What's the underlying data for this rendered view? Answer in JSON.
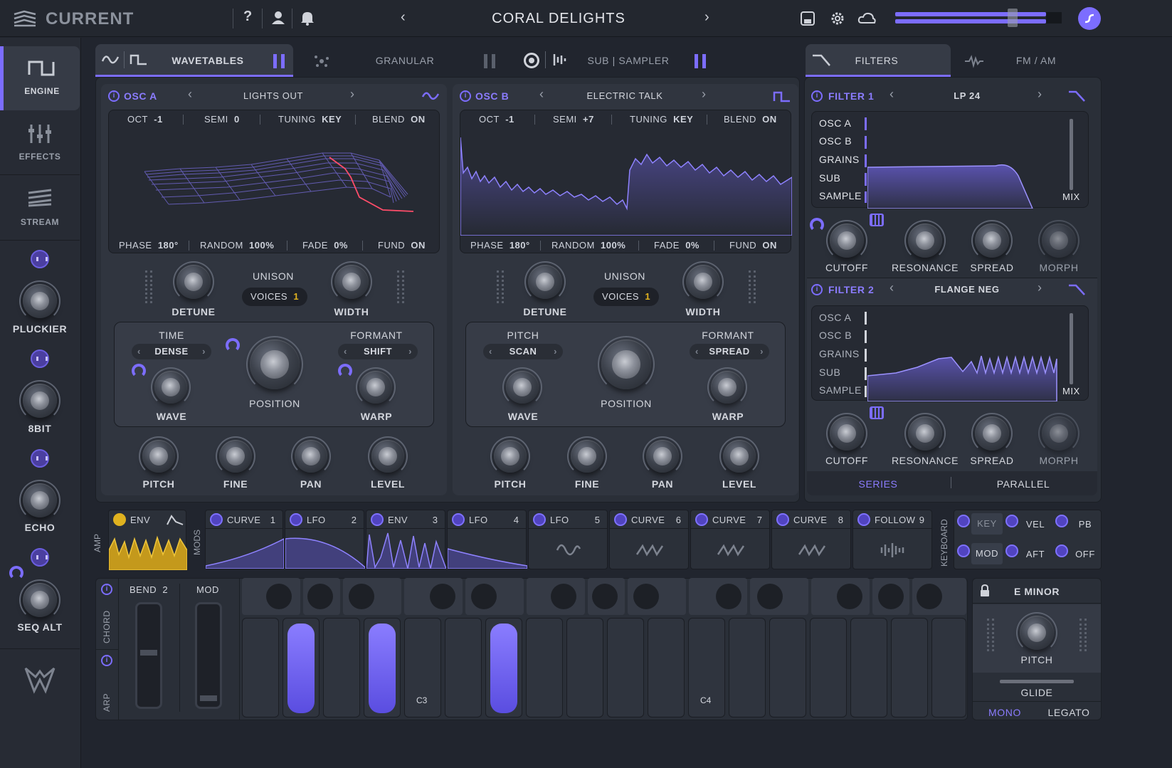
{
  "app": {
    "name": "CURRENT",
    "preset": "CORAL DELIGHTS"
  },
  "sidebar": {
    "nav": [
      {
        "label": "ENGINE",
        "icon": "square-wave-icon"
      },
      {
        "label": "EFFECTS",
        "icon": "sliders-icon"
      },
      {
        "label": "STREAM",
        "icon": "stream-icon"
      }
    ],
    "macros": [
      "PLUCKIER",
      "8BIT",
      "ECHO",
      "SEQ ALT"
    ]
  },
  "tabs": {
    "wavetables": "WAVETABLES",
    "granular": "GRANULAR",
    "sub_sampler": "SUB | SAMPLER",
    "filters": "FILTERS",
    "fm_am": "FM / AM"
  },
  "osc_a": {
    "title": "OSC A",
    "preset": "LIGHTS OUT",
    "oct_label": "OCT",
    "oct": "-1",
    "semi_label": "SEMI",
    "semi": "0",
    "tuning_label": "TUNING",
    "tuning": "KEY",
    "blend_label": "BLEND",
    "blend": "ON",
    "phase_label": "PHASE",
    "phase": "180°",
    "random_label": "RANDOM",
    "random": "100%",
    "fade_label": "FADE",
    "fade": "0%",
    "fund_label": "FUND",
    "fund": "ON",
    "detune": "DETUNE",
    "unison": "UNISON",
    "voices_label": "VOICES",
    "voices": "1",
    "width": "WIDTH",
    "sel_left_label": "TIME",
    "sel_left": "DENSE",
    "sel_right_label": "FORMANT",
    "sel_right": "SHIFT",
    "wave": "WAVE",
    "position": "POSITION",
    "warp": "WARP",
    "pitch": "PITCH",
    "fine": "FINE",
    "pan": "PAN",
    "level": "LEVEL"
  },
  "osc_b": {
    "title": "OSC B",
    "preset": "ELECTRIC TALK",
    "oct_label": "OCT",
    "oct": "-1",
    "semi_label": "SEMI",
    "semi": "+7",
    "tuning_label": "TUNING",
    "tuning": "KEY",
    "blend_label": "BLEND",
    "blend": "ON",
    "phase_label": "PHASE",
    "phase": "180°",
    "random_label": "RANDOM",
    "random": "100%",
    "fade_label": "FADE",
    "fade": "0%",
    "fund_label": "FUND",
    "fund": "ON",
    "detune": "DETUNE",
    "unison": "UNISON",
    "voices_label": "VOICES",
    "voices": "1",
    "width": "WIDTH",
    "sel_left_label": "PITCH",
    "sel_left": "SCAN",
    "sel_right_label": "FORMANT",
    "sel_right": "SPREAD",
    "wave": "WAVE",
    "position": "POSITION",
    "warp": "WARP",
    "pitch": "PITCH",
    "fine": "FINE",
    "pan": "PAN",
    "level": "LEVEL"
  },
  "filter1": {
    "title": "FILTER 1",
    "preset": "LP 24",
    "sources": [
      "OSC A",
      "OSC B",
      "GRAINS",
      "SUB",
      "SAMPLE"
    ],
    "mix": "MIX",
    "knobs": [
      "CUTOFF",
      "RESONANCE",
      "SPREAD",
      "MORPH"
    ]
  },
  "filter2": {
    "title": "FILTER 2",
    "preset": "FLANGE NEG",
    "sources": [
      "OSC A",
      "OSC B",
      "GRAINS",
      "SUB",
      "SAMPLE"
    ],
    "mix": "MIX",
    "knobs": [
      "CUTOFF",
      "RESONANCE",
      "SPREAD",
      "MORPH"
    ]
  },
  "routing": {
    "series": "SERIES",
    "parallel": "PARALLEL"
  },
  "mods": {
    "amp_label": "AMP",
    "mods_label": "MODS",
    "amp_env": "ENV",
    "slots": [
      {
        "name": "CURVE",
        "num": "1"
      },
      {
        "name": "LFO",
        "num": "2"
      },
      {
        "name": "ENV",
        "num": "3"
      },
      {
        "name": "LFO",
        "num": "4"
      },
      {
        "name": "LFO",
        "num": "5"
      },
      {
        "name": "CURVE",
        "num": "6"
      },
      {
        "name": "CURVE",
        "num": "7"
      },
      {
        "name": "CURVE",
        "num": "8"
      },
      {
        "name": "FOLLOW",
        "num": "9"
      }
    ],
    "keyboard_label": "KEYBOARD",
    "kb": [
      "KEY",
      "VEL",
      "PB",
      "MOD",
      "AFT",
      "OFF"
    ]
  },
  "perform": {
    "chord": "CHORD",
    "arp": "ARP",
    "bend_label": "BEND",
    "bend": "2",
    "mod": "MOD",
    "c3": "C3",
    "c4": "C4"
  },
  "scale": {
    "key": "E MINOR",
    "pitch": "PITCH",
    "glide": "GLIDE",
    "mono": "MONO",
    "legato": "LEGATO"
  },
  "colors": {
    "accent": "#7c6dff",
    "amp_env": "#e0b21f",
    "bg": "#21252e"
  }
}
